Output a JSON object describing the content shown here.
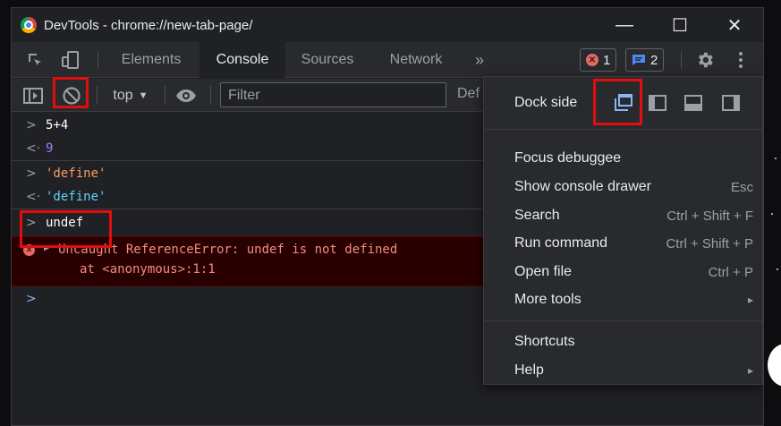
{
  "window": {
    "title": "DevTools - chrome://new-tab-page/",
    "minimize": "—",
    "maximize": "☐",
    "close": "✕"
  },
  "tabs": [
    "Elements",
    "Console",
    "Sources",
    "Network"
  ],
  "active_tab": "Console",
  "more_tabs": "»",
  "badges": {
    "errors": "1",
    "messages": "2"
  },
  "toolbar": {
    "context": "top",
    "filter_placeholder": "Filter",
    "levels_truncated": "Def"
  },
  "console": {
    "entries": [
      {
        "dir": ">",
        "text": "5+4"
      },
      {
        "dir": "<",
        "text": "9"
      },
      {
        "dir": ">",
        "text": "'define'"
      },
      {
        "dir": "<",
        "text": "'define'"
      },
      {
        "dir": ">",
        "text": "undef"
      }
    ],
    "error_line1": "Uncaught ReferenceError: undef is not defined",
    "error_line2": "at <anonymous>:1:1",
    "prompt": ">"
  },
  "menu": {
    "dock_side": "Dock side",
    "items": [
      {
        "label": "Focus debuggee",
        "shortcut": ""
      },
      {
        "label": "Show console drawer",
        "shortcut": "Esc"
      },
      {
        "label": "Search",
        "shortcut": "Ctrl + Shift + F"
      },
      {
        "label": "Run command",
        "shortcut": "Ctrl + Shift + P"
      },
      {
        "label": "Open file",
        "shortcut": "Ctrl + P"
      },
      {
        "label": "More tools",
        "shortcut": "▸"
      },
      {
        "label": "Shortcuts",
        "shortcut": ""
      },
      {
        "label": "Help",
        "shortcut": "▸"
      }
    ]
  },
  "colors": {
    "accent": "#8ab4f8",
    "error": "#f28b82",
    "highlight": "#e20d0d"
  }
}
